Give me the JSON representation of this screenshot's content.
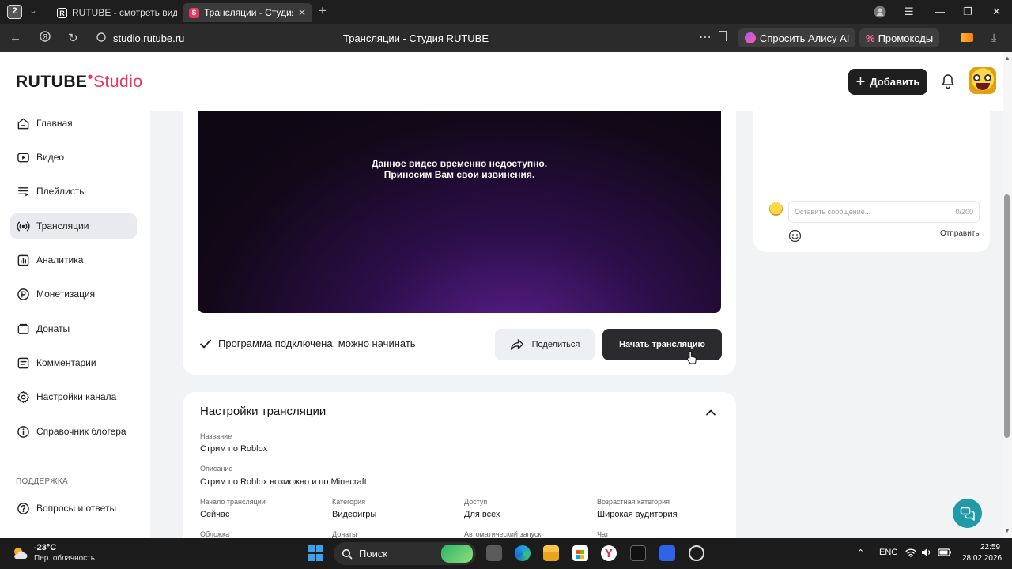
{
  "browser": {
    "tab_count": "2",
    "tabs": [
      {
        "favicon": "R",
        "label": "RUTUBE - смотреть видео"
      },
      {
        "favicon": "S",
        "label": "Трансляции - Студия RUTUBE"
      }
    ],
    "url": "studio.rutube.ru",
    "page_title": "Трансляции - Студия RUTUBE",
    "alice_label": "Спросить Алису AI",
    "promo_label": "Промокоды"
  },
  "header": {
    "logo_main": "RUTUBE",
    "logo_studio": "Studio",
    "add_label": "Добавить"
  },
  "sidebar": {
    "items": [
      {
        "label": "Главная",
        "icon": "home-icon"
      },
      {
        "label": "Видео",
        "icon": "video-icon"
      },
      {
        "label": "Плейлисты",
        "icon": "playlist-icon"
      },
      {
        "label": "Трансляции",
        "icon": "broadcast-icon"
      },
      {
        "label": "Аналитика",
        "icon": "analytics-icon"
      },
      {
        "label": "Монетизация",
        "icon": "ruble-icon"
      },
      {
        "label": "Донаты",
        "icon": "donate-icon"
      },
      {
        "label": "Комментарии",
        "icon": "comments-icon"
      },
      {
        "label": "Настройки канала",
        "icon": "gear-icon"
      },
      {
        "label": "Справочник блогера",
        "icon": "info-icon"
      }
    ],
    "support_heading": "ПОДДЕРЖКА",
    "faq_label": "Вопросы и ответы"
  },
  "player": {
    "line1": "Данное видео временно недоступно.",
    "line2": "Приносим Вам свои извинения."
  },
  "stream_status": {
    "text": "Программа подключена, можно начинать",
    "share_label": "Поделиться",
    "start_label": "Начать трансляцию"
  },
  "settings": {
    "title": "Настройки трансляции",
    "name_label": "Название",
    "name_value": "Стрим по Roblox",
    "desc_label": "Описание",
    "desc_value": "Стрим по Roblox возможно и по Minecraft",
    "start_label": "Начало трансляции",
    "start_value": "Сейчас",
    "category_label": "Категория",
    "category_value": "Видеоигры",
    "access_label": "Доступ",
    "access_value": "Для всех",
    "age_label": "Возрастная категория",
    "age_value": "Широкая аудитория",
    "cover_label": "Обложка",
    "donations_label": "Донаты",
    "autostart_label": "Автоматический запуск",
    "chat_label": "Чат"
  },
  "chat": {
    "placeholder": "Оставить сообщение...",
    "counter": "0/200",
    "send_label": "Отправить"
  },
  "taskbar": {
    "temperature": "-23°C",
    "weather_desc": "Пер. облачность",
    "search_label": "Поиск",
    "lang": "ENG",
    "time": "22:59",
    "date": "28.02.2026"
  },
  "colors": {
    "brand_red": "#e8365d",
    "dark_button": "#2b2b2d",
    "help_teal": "#1f9aa8"
  }
}
